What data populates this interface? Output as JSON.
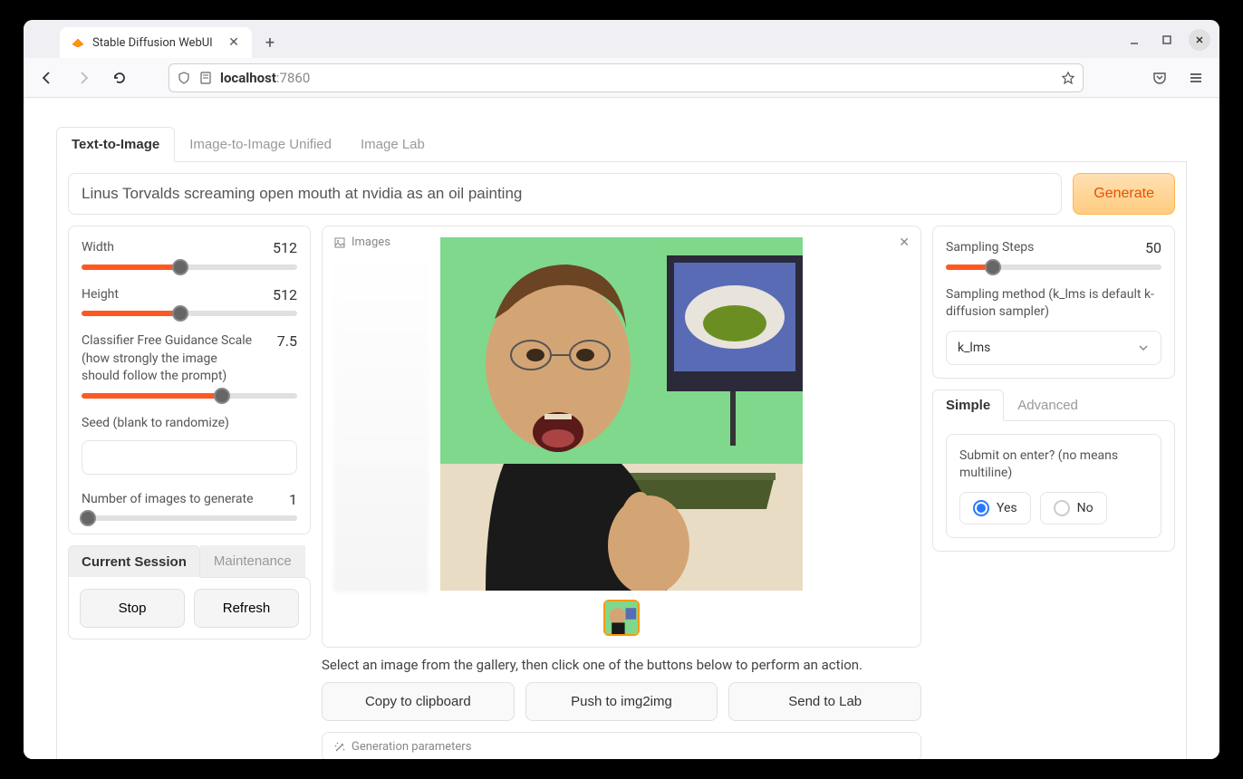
{
  "browser": {
    "tab_title": "Stable Diffusion WebUI",
    "url_host": "localhost",
    "url_port": ":7860"
  },
  "tabs": {
    "t2i": "Text-to-Image",
    "i2i": "Image-to-Image Unified",
    "lab": "Image Lab"
  },
  "prompt": {
    "value": "Linus Torvalds screaming open mouth at nvidia as an oil painting",
    "generate": "Generate"
  },
  "left": {
    "width": {
      "label": "Width",
      "value": "512",
      "percent": 46
    },
    "height": {
      "label": "Height",
      "value": "512",
      "percent": 46
    },
    "cfg": {
      "label": "Classifier Free Guidance Scale (how strongly the image should follow the prompt)",
      "value": "7.5",
      "percent": 65
    },
    "seed": {
      "label": "Seed (blank to randomize)",
      "value": ""
    },
    "num_images": {
      "label": "Number of images to generate",
      "value": "1",
      "percent": 3
    }
  },
  "session": {
    "tab_current": "Current Session",
    "tab_maint": "Maintenance",
    "stop": "Stop",
    "refresh": "Refresh"
  },
  "center": {
    "images_label": "Images",
    "hint": "Select an image from the gallery, then click one of the buttons below to perform an action.",
    "copy": "Copy to clipboard",
    "push": "Push to img2img",
    "send": "Send to Lab",
    "gen_params": "Generation parameters"
  },
  "right": {
    "steps": {
      "label": "Sampling Steps",
      "value": "50",
      "percent": 22
    },
    "method_label": "Sampling method (k_lms is default k-diffusion sampler)",
    "method_value": "k_lms",
    "sub_simple": "Simple",
    "sub_advanced": "Advanced",
    "submit_label": "Submit on enter? (no means multiline)",
    "yes": "Yes",
    "no": "No"
  }
}
